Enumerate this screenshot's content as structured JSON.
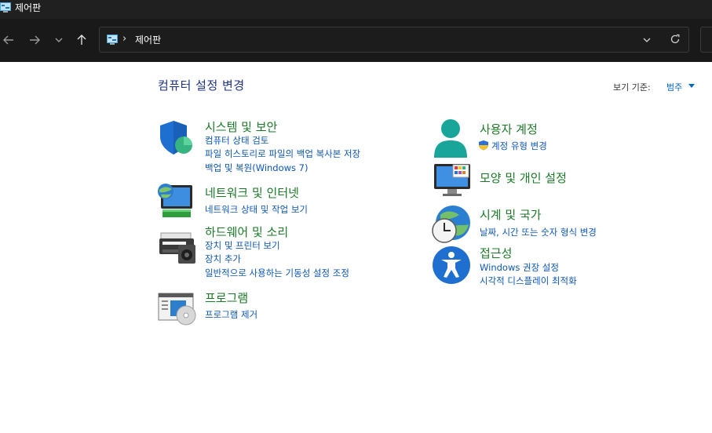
{
  "window": {
    "title": "제어판"
  },
  "nav": {
    "back": "back",
    "forward": "forward",
    "recent": "recent-locations",
    "up": "up"
  },
  "address": {
    "separator": "›",
    "path": "제어판"
  },
  "header": {
    "title": "컴퓨터 설정 변경",
    "view_by_label": "보기 기준:",
    "view_by_value": "범주"
  },
  "categories": [
    {
      "title": "시스템 및 보안",
      "icon": "shield-icon",
      "links": [
        "컴퓨터 상태 검토",
        "파일 히스토리로 파일의 백업 복사본 저장",
        "백업 및 복원(Windows 7)"
      ]
    },
    {
      "title": "네트워크 및 인터넷",
      "icon": "network-icon",
      "links": [
        "네트워크 상태 및 작업 보기"
      ]
    },
    {
      "title": "하드웨어 및 소리",
      "icon": "printer-speaker-icon",
      "links": [
        "장치 및 프린터 보기",
        "장치 추가",
        "일반적으로 사용하는 기동성 설정 조정"
      ]
    },
    {
      "title": "프로그램",
      "icon": "programs-icon",
      "links": [
        "프로그램 제거"
      ]
    },
    {
      "title": "사용자 계정",
      "icon": "user-icon",
      "links": [
        "계정 유형 변경"
      ]
    },
    {
      "title": "모양 및 개인 설정",
      "icon": "monitor-personalize-icon",
      "links": []
    },
    {
      "title": "시계 및 국가",
      "icon": "clock-globe-icon",
      "links": [
        "날짜, 시간 또는 숫자 형식 변경"
      ]
    },
    {
      "title": "접근성",
      "icon": "accessibility-icon",
      "links": [
        "Windows 권장 설정",
        "시각적 디스플레이 최적화"
      ]
    }
  ],
  "colors": {
    "titlebar": "#202020",
    "navbar": "#191919",
    "category_title": "#1b7a28",
    "link": "#0d56b8",
    "page_title": "#1e3287"
  }
}
